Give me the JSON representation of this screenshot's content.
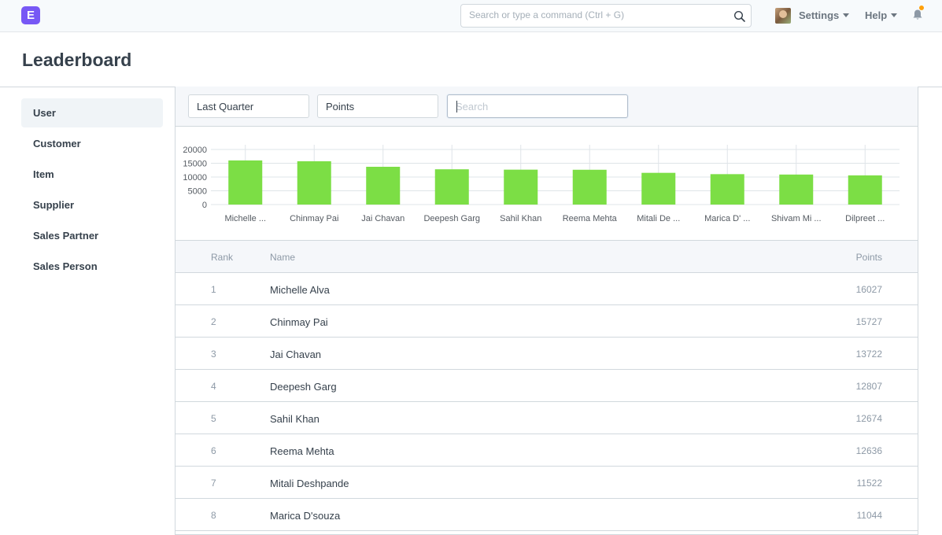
{
  "navbar": {
    "logo": "E",
    "search_placeholder": "Search or type a command (Ctrl + G)",
    "settings_label": "Settings",
    "help_label": "Help"
  },
  "page": {
    "title": "Leaderboard"
  },
  "sidebar": {
    "items": [
      {
        "label": "User",
        "active": true
      },
      {
        "label": "Customer"
      },
      {
        "label": "Item"
      },
      {
        "label": "Supplier"
      },
      {
        "label": "Sales Partner"
      },
      {
        "label": "Sales Person"
      }
    ]
  },
  "filters": {
    "period": "Last Quarter",
    "field": "Points",
    "search_placeholder": "Search"
  },
  "chart_data": {
    "type": "bar",
    "categories": [
      "Michelle ...",
      "Chinmay Pai",
      "Jai Chavan",
      "Deepesh Garg",
      "Sahil Khan",
      "Reema Mehta",
      "Mitali De ...",
      "Marica D' ...",
      "Shivam Mi ...",
      "Dilpreet ..."
    ],
    "values": [
      16027,
      15727,
      13722,
      12807,
      12674,
      12636,
      11522,
      11044,
      10900,
      10600
    ],
    "yticks": [
      0,
      5000,
      10000,
      15000,
      20000
    ],
    "ylim": [
      0,
      20000
    ],
    "color": "#7cde45",
    "grid": true
  },
  "table": {
    "headers": {
      "rank": "Rank",
      "name": "Name",
      "points": "Points"
    },
    "rows": [
      {
        "rank": "1",
        "name": "Michelle Alva",
        "points": "16027"
      },
      {
        "rank": "2",
        "name": "Chinmay Pai",
        "points": "15727"
      },
      {
        "rank": "3",
        "name": "Jai Chavan",
        "points": "13722"
      },
      {
        "rank": "4",
        "name": "Deepesh Garg",
        "points": "12807"
      },
      {
        "rank": "5",
        "name": "Sahil Khan",
        "points": "12674"
      },
      {
        "rank": "6",
        "name": "Reema Mehta",
        "points": "12636"
      },
      {
        "rank": "7",
        "name": "Mitali Deshpande",
        "points": "11522"
      },
      {
        "rank": "8",
        "name": "Marica D'souza",
        "points": "11044"
      }
    ]
  }
}
